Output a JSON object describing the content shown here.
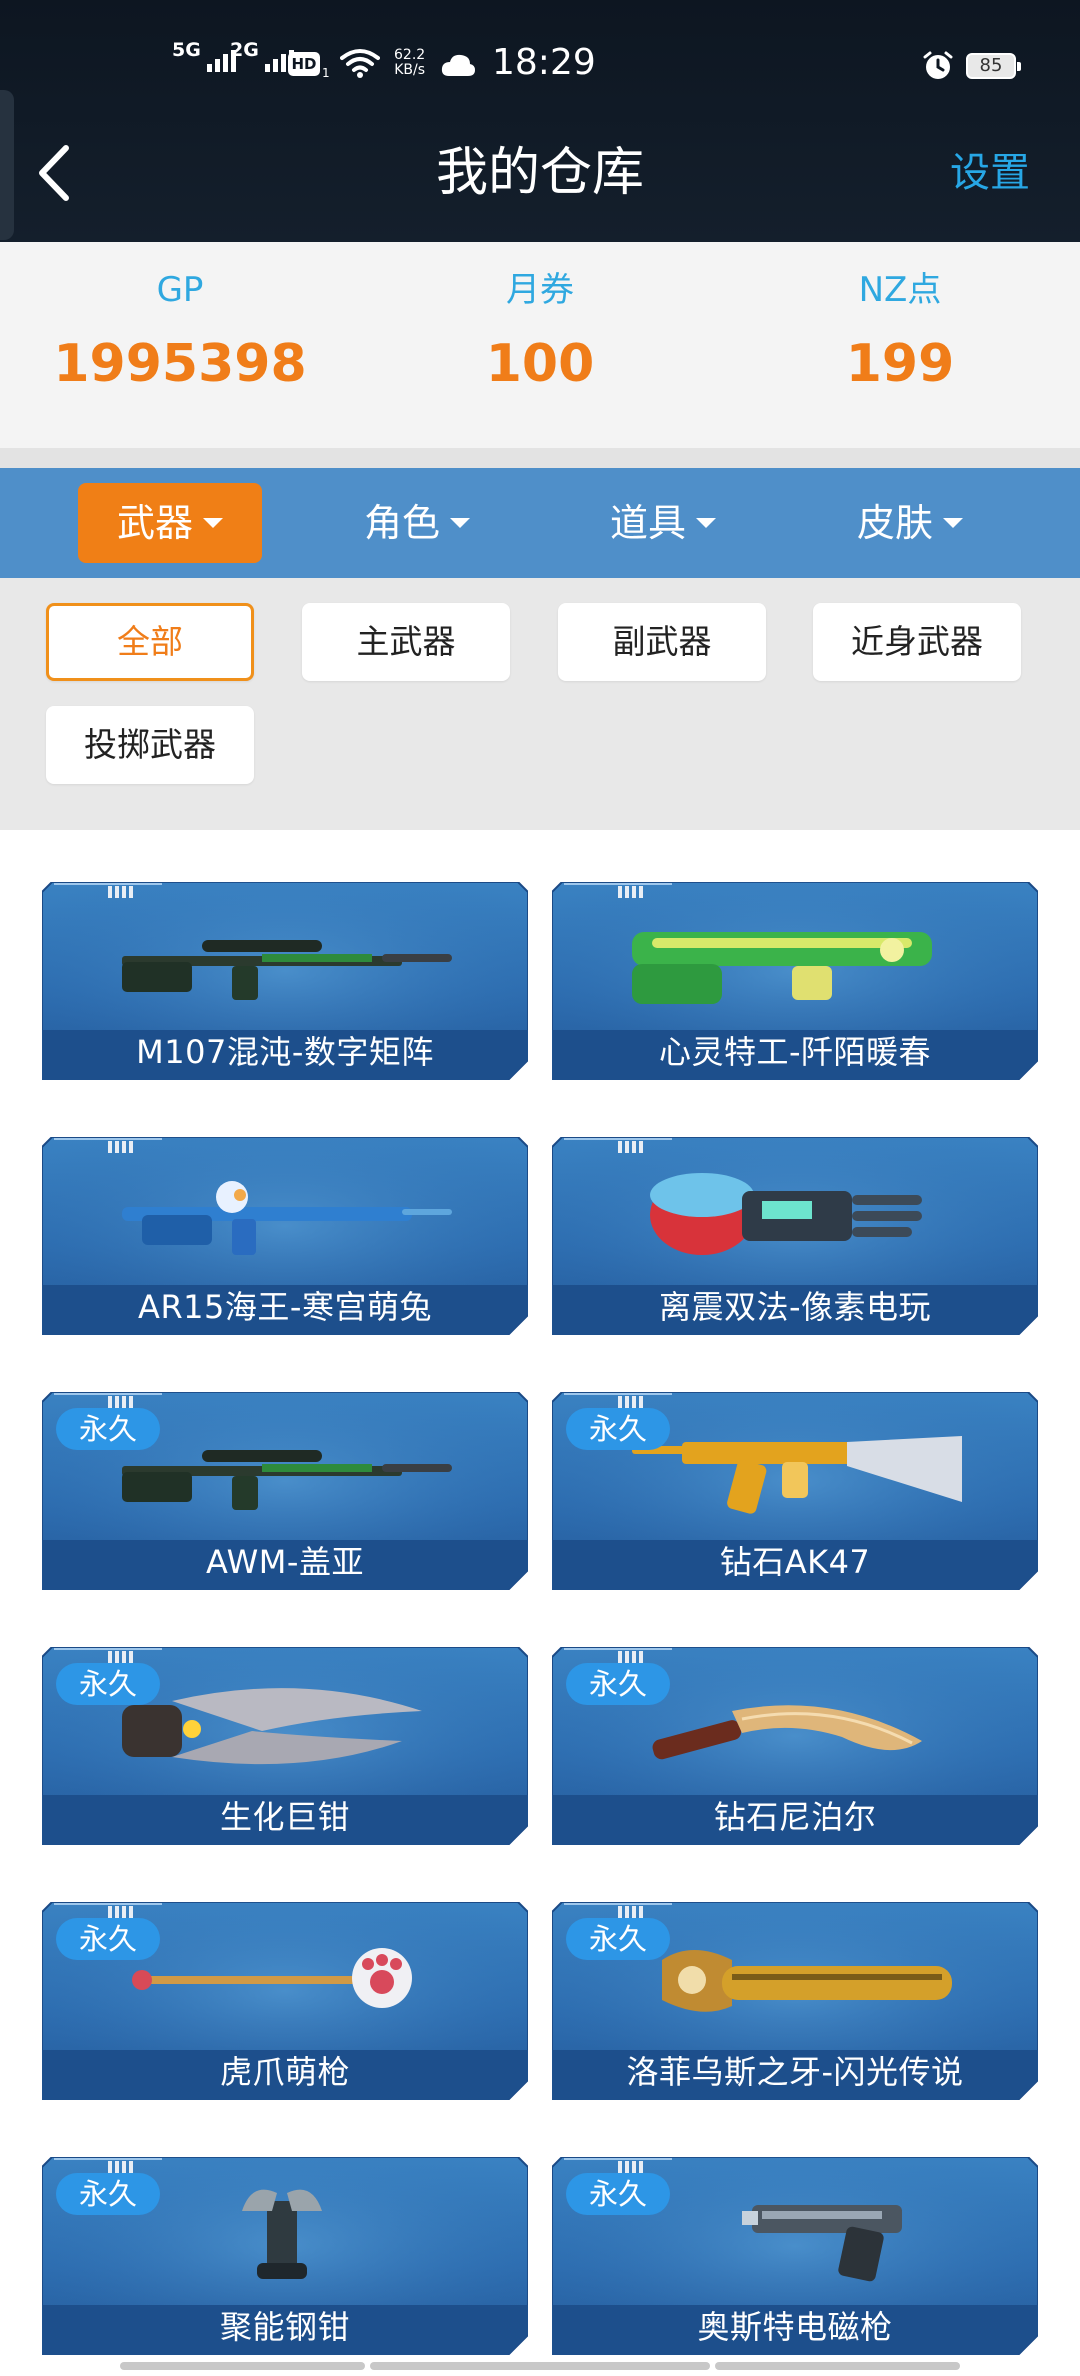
{
  "status_bar": {
    "net1": "5G",
    "net2": "2G",
    "hd": "HD",
    "hd_sub": "1",
    "speed_value": "62.2",
    "speed_unit": "KB/s",
    "time": "18:29",
    "battery": "85"
  },
  "header": {
    "title": "我的仓库",
    "settings_label": "设置"
  },
  "currency": [
    {
      "label": "GP",
      "value": "1995398"
    },
    {
      "label": "月券",
      "value": "100"
    },
    {
      "label": "NZ点",
      "value": "199"
    }
  ],
  "categories": [
    {
      "label": "武器",
      "active": true
    },
    {
      "label": "角色",
      "active": false
    },
    {
      "label": "道具",
      "active": false
    },
    {
      "label": "皮肤",
      "active": false
    }
  ],
  "filters": [
    {
      "label": "全部",
      "active": true
    },
    {
      "label": "主武器",
      "active": false
    },
    {
      "label": "副武器",
      "active": false
    },
    {
      "label": "近身武器",
      "active": false
    },
    {
      "label": "投掷武器",
      "active": false
    }
  ],
  "items": [
    {
      "name": "M107混沌-数字矩阵",
      "badge": null,
      "icon": "sniper-rifle-icon"
    },
    {
      "name": "心灵特工-阡陌暖春",
      "badge": null,
      "icon": "heavy-gun-icon"
    },
    {
      "name": "AR15海王-寒宫萌兔",
      "badge": null,
      "icon": "assault-rifle-icon"
    },
    {
      "name": "离震双法-像素电玩",
      "badge": null,
      "icon": "gauntlet-icon"
    },
    {
      "name": "AWM-盖亚",
      "badge": "永久",
      "icon": "sniper-rifle-icon"
    },
    {
      "name": "钻石AK47",
      "badge": "永久",
      "icon": "ak47-icon"
    },
    {
      "name": "生化巨钳",
      "badge": "永久",
      "icon": "claw-icon"
    },
    {
      "name": "钻石尼泊尔",
      "badge": "永久",
      "icon": "kukri-knife-icon"
    },
    {
      "name": "虎爪萌枪",
      "badge": "永久",
      "icon": "paw-staff-icon"
    },
    {
      "name": "洛菲乌斯之牙-闪光传说",
      "badge": "永久",
      "icon": "chainsaw-icon"
    },
    {
      "name": "聚能钢钳",
      "badge": "永久",
      "icon": "pincer-icon"
    },
    {
      "name": "奥斯特电磁枪",
      "badge": "永久",
      "icon": "pistol-icon"
    }
  ],
  "colors": {
    "accent_orange": "#f07d19",
    "tab_bar_blue": "#4f8fc9",
    "badge_blue": "#2d96e6",
    "link_blue": "#27a7e6",
    "card_blue": "#2f6fb0"
  }
}
